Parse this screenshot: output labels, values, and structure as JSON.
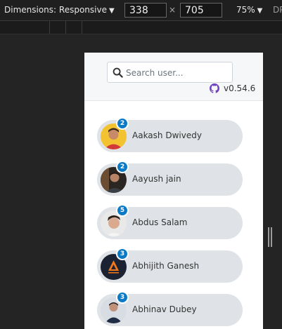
{
  "toolbar": {
    "dimensions_label": "Dimensions: Responsive",
    "width": "338",
    "height": "705",
    "times": "×",
    "zoom": "75%",
    "dpr": "DP"
  },
  "app": {
    "search": {
      "placeholder": "Search user..."
    },
    "version": "v0.54.6",
    "users": [
      {
        "name": "Aakash Dwivedy",
        "count": "2"
      },
      {
        "name": "Aayush jain",
        "count": "2"
      },
      {
        "name": "Abdus Salam",
        "count": "5"
      },
      {
        "name": "Abhijith Ganesh",
        "count": "3"
      },
      {
        "name": "Abhinav Dubey",
        "count": "3"
      }
    ]
  },
  "colors": {
    "accent": "#0b7ac6",
    "github": "#6f42c1",
    "pill": "#dfe2e6"
  }
}
